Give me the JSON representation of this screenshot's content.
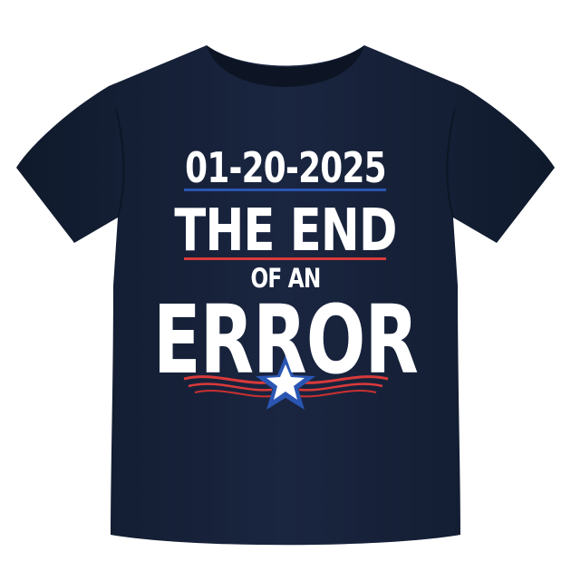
{
  "colors": {
    "background": "#ffffff",
    "shirt": "#172238",
    "shirt_shadow": "#0f1828",
    "print_text": "#ffffff",
    "accent_blue": "#2a56b3",
    "accent_red": "#d93a3a"
  },
  "print": {
    "date": "01-20-2025",
    "line1": "THE END",
    "line2": "OF AN",
    "line3": "ERROR"
  },
  "icons": [
    "star-icon",
    "flag-ribbon-icon"
  ]
}
